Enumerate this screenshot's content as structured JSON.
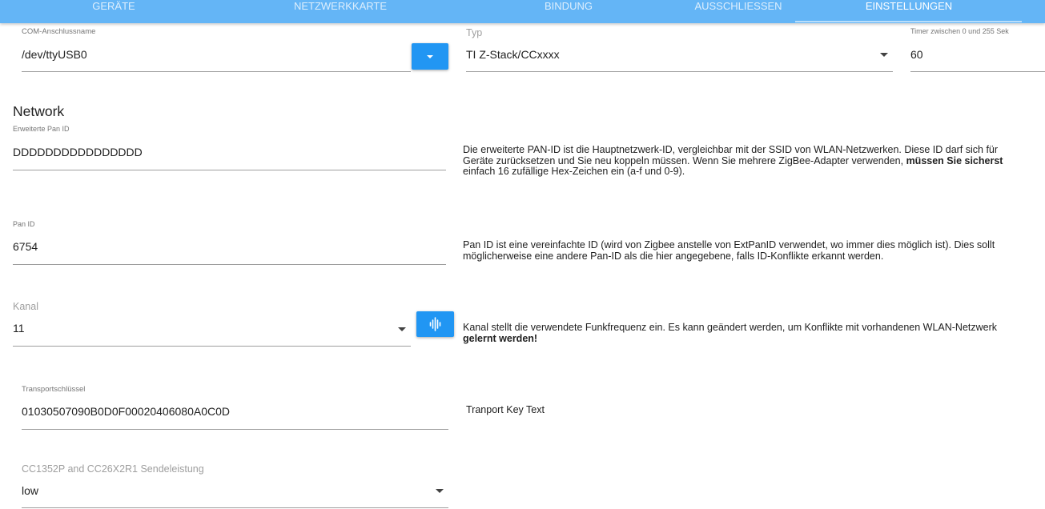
{
  "tabs": [
    {
      "label": "Geräte"
    },
    {
      "label": "Netzwerkkarte"
    },
    {
      "label": "Bindung"
    },
    {
      "label": "Ausschließen"
    },
    {
      "label": "Einstellungen"
    }
  ],
  "active_tab": "Einstellungen",
  "com_port": {
    "label": "COM-Anschlussname",
    "value": "/dev/ttyUSB0"
  },
  "adapter_type": {
    "label": "Typ",
    "value": "TI Z-Stack/CCxxxx"
  },
  "timer": {
    "label": "Timer zwischen 0 und 255 Sek",
    "value": "60"
  },
  "network": {
    "heading": "Network",
    "ext_pan_id": {
      "label": "Erweiterte Pan ID",
      "value": "DDDDDDDDDDDDDDDD",
      "desc_line1": "Die erweiterte PAN-ID ist die Hauptnetzwerk-ID, vergleichbar mit der SSID von WLAN-Netzwerken. Diese ID darf sich für",
      "desc_line2_plain": "Geräte zurücksetzen und Sie neu koppeln müssen. Wenn Sie mehrere ZigBee-Adapter verwenden, ",
      "desc_line2_bold": "müssen Sie sicherst",
      "desc_line3": "einfach 16 zufällige Hex-Zeichen ein (a-f und 0-9)."
    },
    "pan_id": {
      "label": "Pan ID",
      "value": "6754",
      "desc_line1": "Pan ID ist eine vereinfachte ID (wird von Zigbee anstelle von ExtPanID verwendet, wo immer dies möglich ist). Dies sollt",
      "desc_line2": "möglicherweise eine andere Pan-ID als die hier angegebene, falls ID-Konflikte erkannt werden."
    },
    "channel": {
      "label": "Kanal",
      "value": "11",
      "desc_line1": "Kanal stellt die verwendete Funkfrequenz ein. Es kann geändert werden, um Konflikte mit vorhandenen WLAN-Netzwerk",
      "desc_line2_bold": "gelernt werden!"
    },
    "transport_key": {
      "label": "Transportschlüssel",
      "value": "01030507090B0D0F00020406080A0C0D",
      "desc": "Tranport Key Text"
    },
    "tx_power": {
      "label": "CC1352P and CC26X2R1 Sendeleistung",
      "value": "low"
    }
  },
  "colors": {
    "tab_bar": "#64b5f6",
    "button": "#2196f3",
    "underline": "#9e9e9e"
  }
}
